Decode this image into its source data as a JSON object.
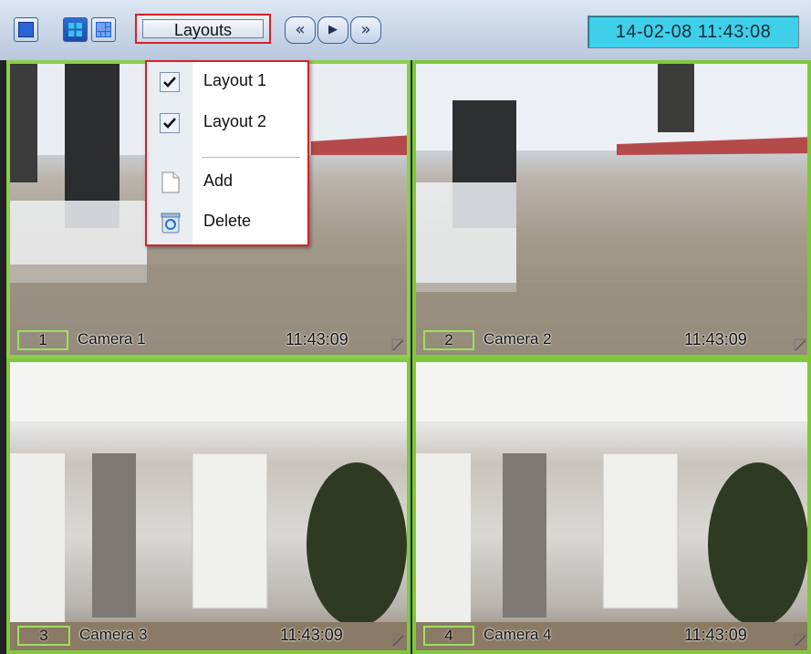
{
  "toolbar": {
    "layouts_label": "Layouts",
    "nav_buttons": [
      "«",
      "▶",
      "»"
    ],
    "datetime": "14-02-08  11:43:08",
    "view_buttons": [
      "single-view-icon",
      "grid-2x2-icon",
      "grid-3x3-icon"
    ]
  },
  "menu": {
    "items": [
      {
        "label": "Layout 1",
        "checked": true,
        "icon": "checkmark-icon"
      },
      {
        "label": "Layout 2",
        "checked": true,
        "icon": "checkmark-icon"
      },
      {
        "label": "Add",
        "icon": "new-document-icon"
      },
      {
        "label": "Delete",
        "icon": "delete-icon"
      }
    ]
  },
  "cameras": [
    {
      "number": "1",
      "name": "Camera 1",
      "time": "11:43:09"
    },
    {
      "number": "2",
      "name": "Camera 2",
      "time": "11:43:09"
    },
    {
      "number": "3",
      "name": "Camera 3",
      "time": "11:43:09"
    },
    {
      "number": "4",
      "name": "Camera 4",
      "time": "11:43:09"
    }
  ],
  "colors": {
    "active_border": "#7fc83c",
    "highlight": "#d8202a",
    "clock_bg": "#3ed0e8"
  }
}
